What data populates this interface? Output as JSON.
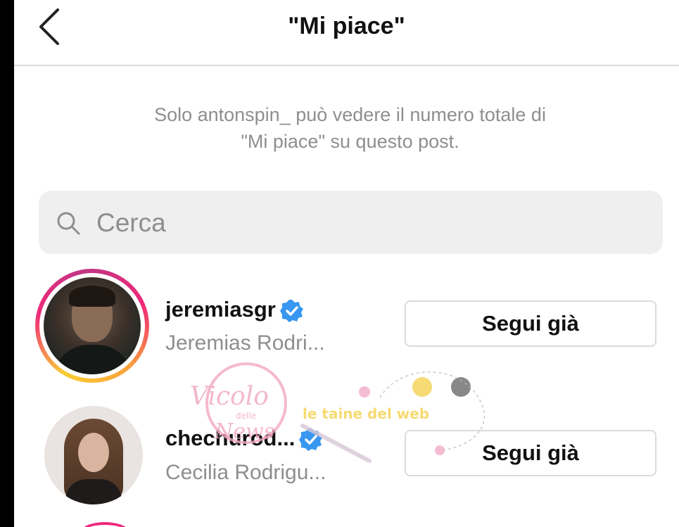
{
  "header": {
    "title": "\"Mi piace\"",
    "back_icon": "chevron-left-icon"
  },
  "notice": {
    "line1": "Solo antonspin_ può vedere il numero totale di",
    "line2": "\"Mi piace\" su questo post."
  },
  "search": {
    "placeholder": "Cerca",
    "value": "",
    "icon": "search-icon"
  },
  "users": [
    {
      "username": "jeremiasgr",
      "full_name": "Jeremias Rodri...",
      "verified": true,
      "has_story_ring": true,
      "button_label": "Segui già"
    },
    {
      "username": "chechurod...",
      "full_name": "Cecilia Rodrigu...",
      "verified": true,
      "has_story_ring": false,
      "button_label": "Segui già"
    }
  ],
  "watermark": {
    "text1": "Vicolo",
    "text2": "delle",
    "text3": "News",
    "text4": "le taine del web"
  },
  "colors": {
    "verified_blue": "#3897f0",
    "ring_pink": "#ee2a7b",
    "ring_yellow": "#f9ce34",
    "muted_text": "#8e8e8e"
  }
}
